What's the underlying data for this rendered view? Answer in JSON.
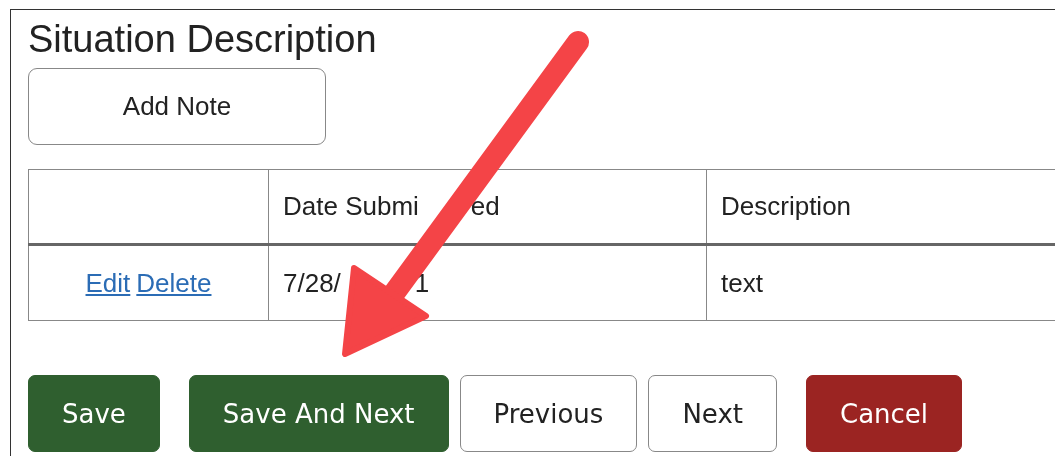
{
  "section": {
    "title": "Situation Description"
  },
  "add_note_button": {
    "label": "Add Note"
  },
  "table": {
    "columns": [
      {
        "visible_parts": [
          "Date Submi",
          "ed"
        ]
      },
      {
        "visible_parts": [
          "Description"
        ]
      }
    ],
    "rows": [
      {
        "actions": [
          "Edit",
          "Delete"
        ],
        "date_submitted_parts": [
          "7/28/",
          "1"
        ],
        "description": "text"
      }
    ]
  },
  "buttons": [
    {
      "label": "Save",
      "kind": "primary"
    },
    {
      "label": "Save And Next",
      "kind": "primary"
    },
    {
      "label": "Previous",
      "kind": "secondary"
    },
    {
      "label": "Next",
      "kind": "secondary"
    },
    {
      "label": "Cancel",
      "kind": "danger"
    }
  ]
}
